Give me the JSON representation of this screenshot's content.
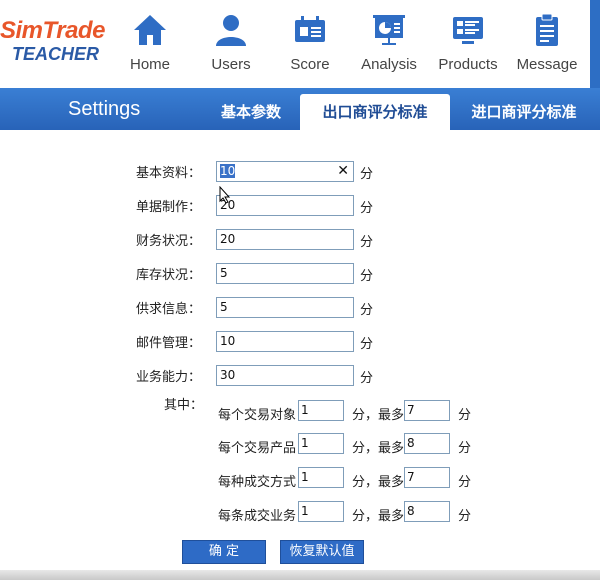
{
  "logo": {
    "line1": "SimTrade",
    "line2": "TEACHER"
  },
  "nav": [
    {
      "label": "Home",
      "icon": "house-icon"
    },
    {
      "label": "Users",
      "icon": "user-icon"
    },
    {
      "label": "Score",
      "icon": "score-card-icon"
    },
    {
      "label": "Analysis",
      "icon": "presentation-chart-icon"
    },
    {
      "label": "Products",
      "icon": "product-list-icon"
    },
    {
      "label": "Message",
      "icon": "message-clipboard-icon"
    }
  ],
  "band": {
    "title": "Settings",
    "tabs": [
      {
        "label": "基本参数",
        "active": false
      },
      {
        "label": "出口商评分标准",
        "active": true
      },
      {
        "label": "进口商评分标准",
        "active": false
      }
    ]
  },
  "form": {
    "unit": "分",
    "rows": [
      {
        "label": "基本资料：",
        "value": "10"
      },
      {
        "label": "单据制作：",
        "value": "20"
      },
      {
        "label": "财务状况：",
        "value": "20"
      },
      {
        "label": "库存状况：",
        "value": "5"
      },
      {
        "label": "供求信息：",
        "value": "5"
      },
      {
        "label": "邮件管理：",
        "value": "10"
      },
      {
        "label": "业务能力：",
        "value": "30"
      }
    ],
    "sub_heading": "其中：",
    "sub_rows": [
      {
        "label": "每个交易对象",
        "value": "1",
        "max_label": "分，最多",
        "max_value": "7"
      },
      {
        "label": "每个交易产品",
        "value": "1",
        "max_label": "分，最多",
        "max_value": "8"
      },
      {
        "label": "每种成交方式",
        "value": "1",
        "max_label": "分，最多",
        "max_value": "7"
      },
      {
        "label": "每条成交业务",
        "value": "1",
        "max_label": "分，最多",
        "max_value": "8"
      }
    ]
  },
  "buttons": {
    "confirm": "确 定",
    "restore": "恢复默认值"
  },
  "colors": {
    "brand_orange": "#e8562a",
    "brand_blue": "#2a5aa6",
    "band_blue": "#2863b8",
    "nav_icon_blue": "#2f6dc4"
  }
}
